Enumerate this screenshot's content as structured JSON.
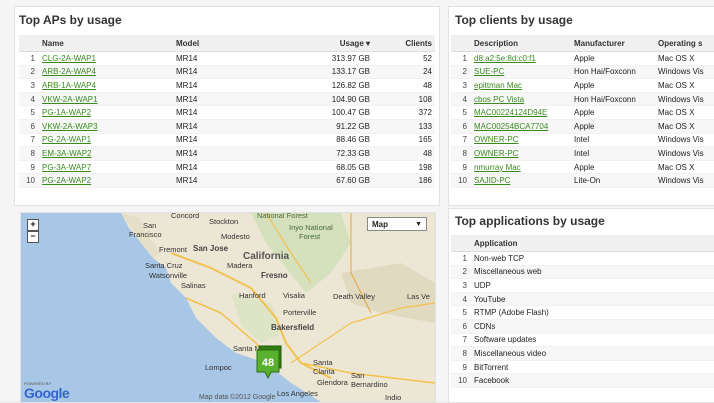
{
  "top_aps": {
    "title": "Top APs by usage",
    "columns": {
      "name": "Name",
      "model": "Model",
      "usage": "Usage ▾",
      "clients": "Clients"
    },
    "rows": [
      {
        "idx": "1",
        "name": "CLG-2A-WAP1",
        "model": "MR14",
        "usage": "313.97 GB",
        "clients": "52"
      },
      {
        "idx": "2",
        "name": "ARB-2A-WAP4",
        "model": "MR14",
        "usage": "133.17 GB",
        "clients": "24"
      },
      {
        "idx": "3",
        "name": "ARB-1A-WAP4",
        "model": "MR14",
        "usage": "126.82 GB",
        "clients": "48"
      },
      {
        "idx": "4",
        "name": "VKW-2A-WAP1",
        "model": "MR14",
        "usage": "104.90 GB",
        "clients": "108"
      },
      {
        "idx": "5",
        "name": "PG-1A-WAP2",
        "model": "MR14",
        "usage": "100.47 GB",
        "clients": "372"
      },
      {
        "idx": "6",
        "name": "VKW-2A-WAP3",
        "model": "MR14",
        "usage": "91.22 GB",
        "clients": "133"
      },
      {
        "idx": "7",
        "name": "PG-2A-WAP1",
        "model": "MR14",
        "usage": "88.46 GB",
        "clients": "165"
      },
      {
        "idx": "8",
        "name": "EM-3A-WAP2",
        "model": "MR14",
        "usage": "72.33 GB",
        "clients": "48"
      },
      {
        "idx": "9",
        "name": "PG-3A-WAP7",
        "model": "MR14",
        "usage": "68.05 GB",
        "clients": "198"
      },
      {
        "idx": "10",
        "name": "PG-2A-WAP2",
        "model": "MR14",
        "usage": "67.60 GB",
        "clients": "186"
      }
    ]
  },
  "top_clients": {
    "title": "Top clients by usage",
    "columns": {
      "description": "Description",
      "manufacturer": "Manufacturer",
      "os": "Operating s"
    },
    "rows": [
      {
        "idx": "1",
        "description": "d8:a2:5e:8d:c0:f1",
        "manufacturer": "Apple",
        "os": "Mac OS X"
      },
      {
        "idx": "2",
        "description": "SUE-PC",
        "manufacturer": "Hon Hai/Foxconn",
        "os": "Windows Vis"
      },
      {
        "idx": "3",
        "description": "epittman Mac",
        "manufacturer": "Apple",
        "os": "Mac OS X"
      },
      {
        "idx": "4",
        "description": "cbos PC Vista",
        "manufacturer": "Hon Hai/Foxconn",
        "os": "Windows Vis"
      },
      {
        "idx": "5",
        "description": "MAC00224124D94E",
        "manufacturer": "Apple",
        "os": "Mac OS X"
      },
      {
        "idx": "6",
        "description": "MAC00254BCA7704",
        "manufacturer": "Apple",
        "os": "Mac OS X"
      },
      {
        "idx": "7",
        "description": "OWNER-PC",
        "manufacturer": "Intel",
        "os": "Windows Vis"
      },
      {
        "idx": "8",
        "description": "OWNER-PC",
        "manufacturer": "Intel",
        "os": "Windows Vis"
      },
      {
        "idx": "9",
        "description": "nmurray Mac",
        "manufacturer": "Apple",
        "os": "Mac OS X"
      },
      {
        "idx": "10",
        "description": "SAJID-PC",
        "manufacturer": "Lite-On",
        "os": "Windows Vis"
      }
    ]
  },
  "top_apps": {
    "title": "Top applications by usage",
    "columns": {
      "application": "Application"
    },
    "rows": [
      {
        "idx": "1",
        "name": "Non-web TCP"
      },
      {
        "idx": "2",
        "name": "Miscellaneous web"
      },
      {
        "idx": "3",
        "name": "UDP"
      },
      {
        "idx": "4",
        "name": "YouTube"
      },
      {
        "idx": "5",
        "name": "RTMP (Adobe Flash)"
      },
      {
        "idx": "6",
        "name": "CDNs"
      },
      {
        "idx": "7",
        "name": "Software updates"
      },
      {
        "idx": "8",
        "name": "Miscellaneous video"
      },
      {
        "idx": "9",
        "name": "BitTorrent"
      },
      {
        "idx": "10",
        "name": "Facebook"
      }
    ]
  },
  "map": {
    "type_select": "Map",
    "zoom_in": "+",
    "zoom_out": "−",
    "marker_count": "48",
    "powered_by": "POWERED BY",
    "google": "Google",
    "map_data": "Map data ©2012 Google",
    "labels": {
      "concord": "Concord",
      "san": "San",
      "francisco": "Francisco",
      "stockton": "Stockton",
      "modesto": "Modesto",
      "national_forest": "National Forest",
      "inyo_national_forest": "Inyo National",
      "forest": "Forest",
      "fremont": "Fremont",
      "san_jose": "San Jose",
      "california": "California",
      "santa_cruz": "Santa Cruz",
      "madera": "Madera",
      "watsonville": "Watsonville",
      "fresno": "Fresno",
      "salinas": "Salinas",
      "hanford": "Hanford",
      "visalia": "Visalia",
      "death_valley": "Death Valley",
      "las_vegas": "Las Ve",
      "porterville": "Porterville",
      "bakersfield": "Bakersfield",
      "santa_maria": "Santa Ma",
      "lompoc": "Lompoc",
      "santa": "Santa",
      "clarita": "Clarita",
      "glendora": "Glendora",
      "san_bernardino": "San\nBernardino",
      "los_angeles": "Los Angeles",
      "indio": "Indio"
    }
  }
}
